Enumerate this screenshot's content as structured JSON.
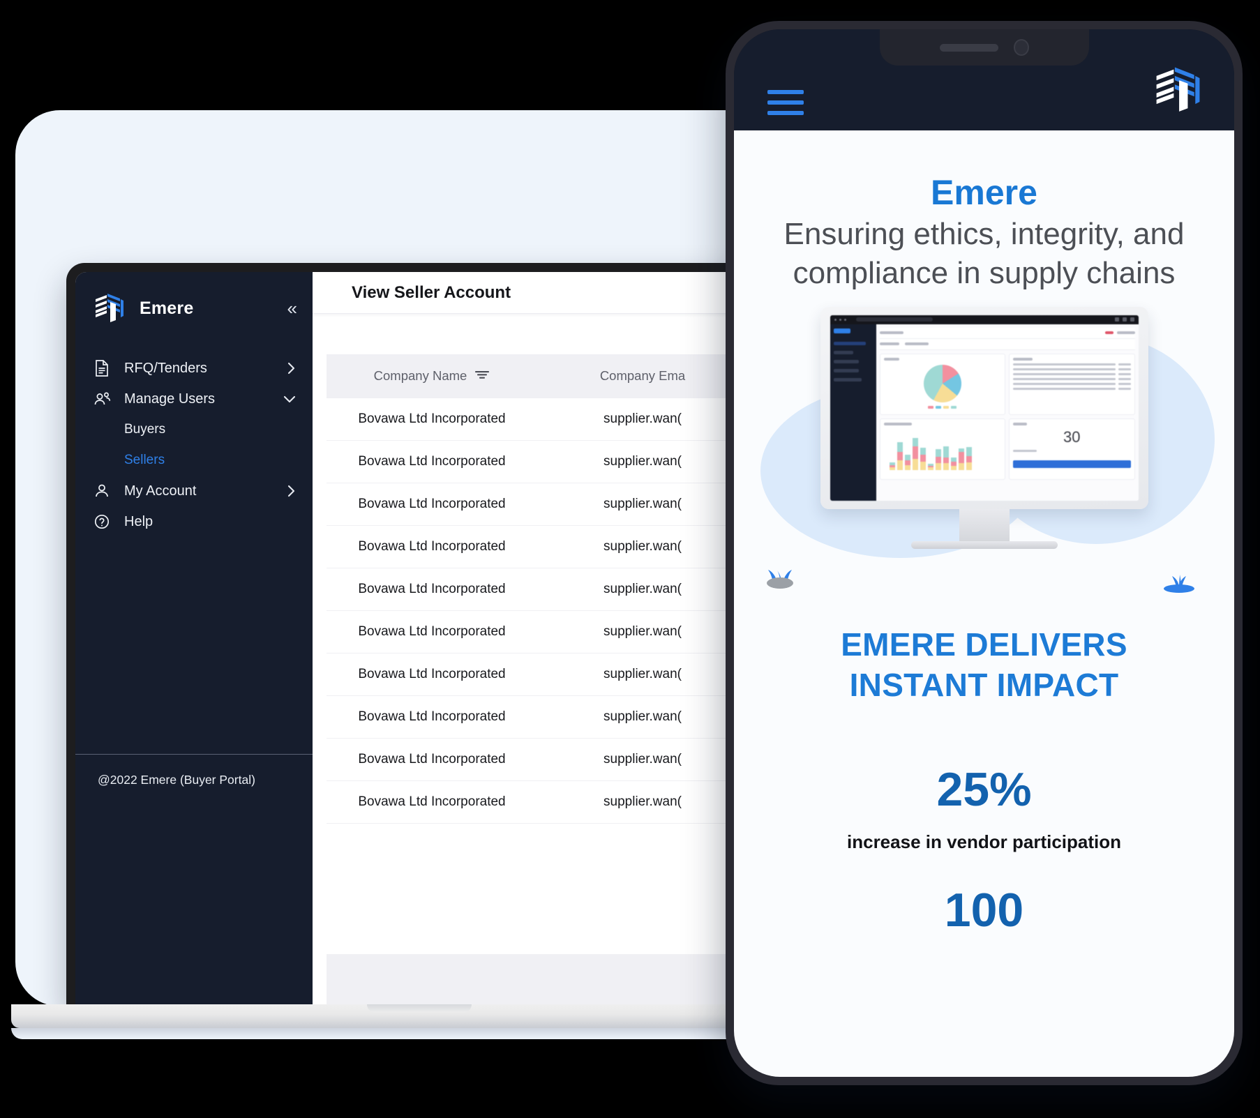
{
  "backdrop": {
    "color": "#eef4fb"
  },
  "brand_colors": {
    "accent": "#2f80e8",
    "dark": "#161d2d",
    "deep_blue": "#1362ae"
  },
  "laptop": {
    "sidebar": {
      "brand_name": "Emere",
      "logo_icon": "emere-logo-icon",
      "collapse_icon": "double-chevron-left-icon",
      "items": [
        {
          "label": "RFQ/Tenders",
          "icon": "document-icon",
          "caret": "chevron-right-icon"
        },
        {
          "label": "Manage Users",
          "icon": "users-icon",
          "caret": "chevron-down-icon"
        },
        {
          "label": "My Account",
          "icon": "person-icon",
          "caret": "chevron-right-icon"
        },
        {
          "label": "Help",
          "icon": "question-circle-icon",
          "caret": ""
        }
      ],
      "sub_items": [
        {
          "label": "Buyers",
          "active": false
        },
        {
          "label": "Sellers",
          "active": true
        }
      ],
      "footer_text": "@2022 Emere (Buyer Portal)"
    },
    "main": {
      "page_title": "View Seller Account",
      "table": {
        "columns": [
          {
            "label": "Company Name",
            "filter_icon": "filter-icon"
          },
          {
            "label": "Company Ema",
            "filter_icon": ""
          }
        ],
        "rows": [
          {
            "company_name": "Bovawa Ltd Incorporated",
            "company_email": "supplier.wan("
          },
          {
            "company_name": "Bovawa Ltd Incorporated",
            "company_email": "supplier.wan("
          },
          {
            "company_name": "Bovawa Ltd Incorporated",
            "company_email": "supplier.wan("
          },
          {
            "company_name": "Bovawa Ltd Incorporated",
            "company_email": "supplier.wan("
          },
          {
            "company_name": "Bovawa Ltd Incorporated",
            "company_email": "supplier.wan("
          },
          {
            "company_name": "Bovawa Ltd Incorporated",
            "company_email": "supplier.wan("
          },
          {
            "company_name": "Bovawa Ltd Incorporated",
            "company_email": "supplier.wan("
          },
          {
            "company_name": "Bovawa Ltd Incorporated",
            "company_email": "supplier.wan("
          },
          {
            "company_name": "Bovawa Ltd Incorporated",
            "company_email": "supplier.wan("
          },
          {
            "company_name": "Bovawa Ltd Incorporated",
            "company_email": "supplier.wan("
          }
        ]
      }
    }
  },
  "phone": {
    "topbar": {
      "menu_icon": "hamburger-menu-icon",
      "logo_icon": "emere-logo-icon"
    },
    "hero": {
      "brand": "Emere",
      "tagline_line1": "Ensuring ethics, integrity, and",
      "tagline_line2": "compliance in supply chains"
    },
    "illustration": {
      "monitor_icon": "desktop-monitor-icon",
      "deco_left_icon": "plant-rock-icon",
      "deco_right_icon": "plant-sprout-icon",
      "dashboard_stat": "30"
    },
    "impact": {
      "line1": "EMERE DELIVERS",
      "line2": "INSTANT IMPACT"
    },
    "stats": [
      {
        "value": "25%",
        "label": "increase in vendor participation"
      },
      {
        "value": "100",
        "label": ""
      }
    ]
  }
}
